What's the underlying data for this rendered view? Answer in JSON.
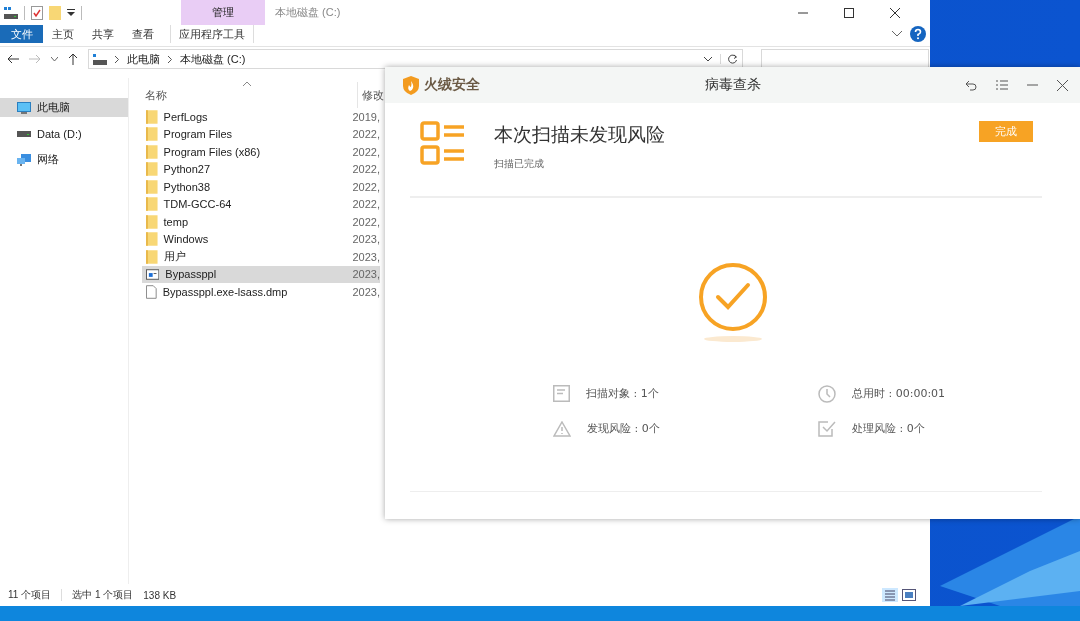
{
  "explorer": {
    "title": "本地磁盘 (C:)",
    "context_group": "管理",
    "ribbon_tabs": [
      {
        "label": "文件",
        "kind": "file"
      },
      {
        "label": "主页",
        "kind": "tab"
      },
      {
        "label": "共享",
        "kind": "tab"
      },
      {
        "label": "查看",
        "kind": "tab"
      },
      {
        "label": "应用程序工具",
        "kind": "context"
      }
    ],
    "breadcrumb": [
      "此电脑",
      "本地磁盘 (C:)"
    ],
    "nav": [
      {
        "label": "此电脑",
        "kind": "pc",
        "selected": true
      },
      {
        "label": "Data (D:)",
        "kind": "drive",
        "selected": false
      },
      {
        "label": "网络",
        "kind": "network",
        "selected": false
      }
    ],
    "columns": [
      "名称",
      "修改"
    ],
    "files": [
      {
        "name": "PerfLogs",
        "date": "2019,",
        "kind": "folder",
        "selected": false
      },
      {
        "name": "Program Files",
        "date": "2022,",
        "kind": "folder",
        "selected": false
      },
      {
        "name": "Program Files (x86)",
        "date": "2022,",
        "kind": "folder",
        "selected": false
      },
      {
        "name": "Python27",
        "date": "2022,",
        "kind": "folder",
        "selected": false
      },
      {
        "name": "Python38",
        "date": "2022,",
        "kind": "folder",
        "selected": false
      },
      {
        "name": "TDM-GCC-64",
        "date": "2022,",
        "kind": "folder",
        "selected": false
      },
      {
        "name": "temp",
        "date": "2022,",
        "kind": "folder",
        "selected": false
      },
      {
        "name": "Windows",
        "date": "2023,",
        "kind": "folder",
        "selected": false
      },
      {
        "name": "用户",
        "date": "2023,",
        "kind": "folder",
        "selected": false
      },
      {
        "name": "Bypassppl",
        "date": "2023,",
        "kind": "app",
        "selected": true
      },
      {
        "name": "Bypassppl.exe-lsass.dmp",
        "date": "2023,",
        "kind": "file",
        "selected": false
      }
    ],
    "status_bar": [
      "11 个项目",
      "选中 1 个项目",
      "138 KB"
    ]
  },
  "scanner": {
    "brand": "火绒安全",
    "title": "病毒查杀",
    "heading": "本次扫描未发现风险",
    "subtitle": "扫描已完成",
    "button": "完成",
    "stats": [
      {
        "kind": "document",
        "text": "扫描对象 : 1个"
      },
      {
        "kind": "clock",
        "text": "总用时 : 00:00:01"
      },
      {
        "kind": "warning",
        "text": "发现风险 : 0个"
      },
      {
        "kind": "check",
        "text": "处理风险 : 0个"
      }
    ]
  }
}
